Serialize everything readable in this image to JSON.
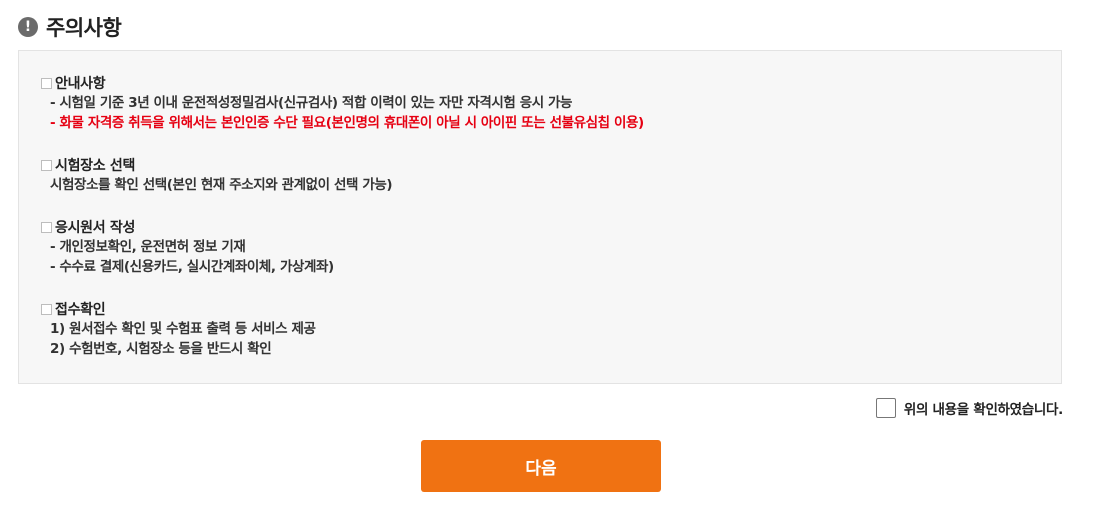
{
  "header": {
    "title": "주의사항",
    "icon": "alert-icon"
  },
  "sections": [
    {
      "title": "안내사항",
      "lines": [
        {
          "text": "- 시험일 기준 3년 이내 운전적성정밀검사(신규검사) 적합 이력이 있는 자만 자격시험 응시 가능",
          "color": "#333333"
        },
        {
          "text": "- 화물 자격증 취득을 위해서는 본인인증 수단 필요(본인명의 휴대폰이 아닐 시 아이핀 또는 선불유심칩 이용)",
          "color": "#e60012"
        }
      ]
    },
    {
      "title": "시험장소 선택",
      "lines": [
        {
          "text": "시험장소를 확인 선택(본인 현재 주소지와 관계없이 선택 가능)",
          "color": "#333333"
        }
      ]
    },
    {
      "title": "응시원서 작성",
      "lines": [
        {
          "text": "- 개인정보확인, 운전면허 정보 기재",
          "color": "#333333"
        },
        {
          "text": "- 수수료 결제(신용카드, 실시간계좌이체, 가상계좌)",
          "color": "#333333"
        }
      ]
    },
    {
      "title": "접수확인",
      "lines": [
        {
          "text": "1) 원서접수 확인 및 수험표 출력 등 서비스 제공",
          "color": "#333333"
        },
        {
          "text": "2) 수험번호, 시험장소 등을 반드시 확인",
          "color": "#333333"
        }
      ]
    }
  ],
  "confirm": {
    "label": "위의 내용을 확인하였습니다.",
    "checked": false
  },
  "next_button": {
    "label": "다음",
    "color": "#f07212"
  }
}
